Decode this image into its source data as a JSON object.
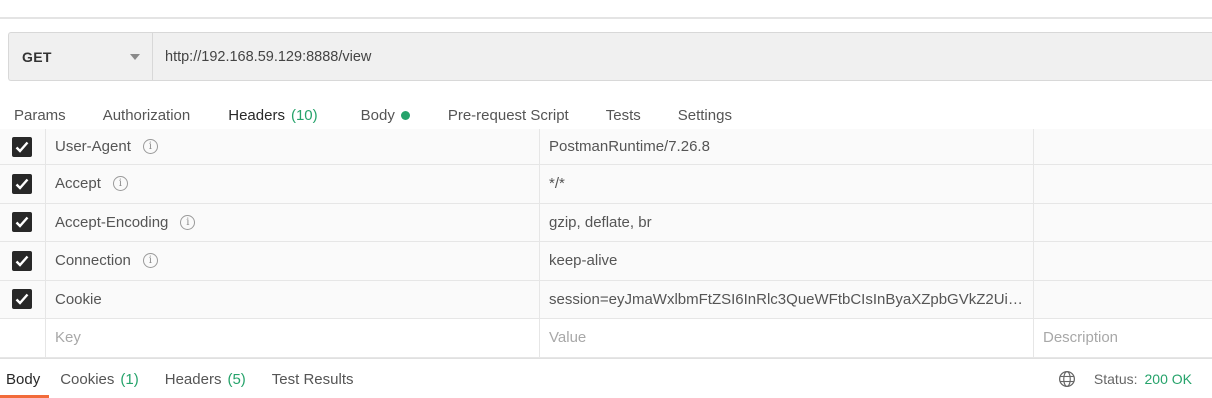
{
  "request": {
    "method": "GET",
    "url": "http://192.168.59.129:8888/view"
  },
  "tabs": [
    {
      "label": "Params"
    },
    {
      "label": "Authorization"
    },
    {
      "label": "Headers",
      "count": "(10)"
    },
    {
      "label": "Body"
    },
    {
      "label": "Pre-request Script"
    },
    {
      "label": "Tests"
    },
    {
      "label": "Settings"
    }
  ],
  "headers": [
    {
      "key": "User-Agent",
      "value": "PostmanRuntime/7.26.8",
      "checked": true,
      "info": true
    },
    {
      "key": "Accept",
      "value": "*/*",
      "checked": true,
      "info": true
    },
    {
      "key": "Accept-Encoding",
      "value": "gzip, deflate, br",
      "checked": true,
      "info": true
    },
    {
      "key": "Connection",
      "value": "keep-alive",
      "checked": true,
      "info": true
    },
    {
      "key": "Cookie",
      "value": "session=eyJmaWxlbmFtZSI6InRlc3QueWFtbCIsInByaXZpbGVkZ2Ui…",
      "checked": true,
      "info": false
    }
  ],
  "placeholders": {
    "key": "Key",
    "value": "Value",
    "description": "Description"
  },
  "response_tabs": [
    {
      "label": "Body"
    },
    {
      "label": "Cookies",
      "count": "(1)"
    },
    {
      "label": "Headers",
      "count": "(5)"
    },
    {
      "label": "Test Results"
    }
  ],
  "status": {
    "label": "Status:",
    "code": "200 OK"
  },
  "colors": {
    "accent": "#f26b3a",
    "success": "#26a36b"
  }
}
